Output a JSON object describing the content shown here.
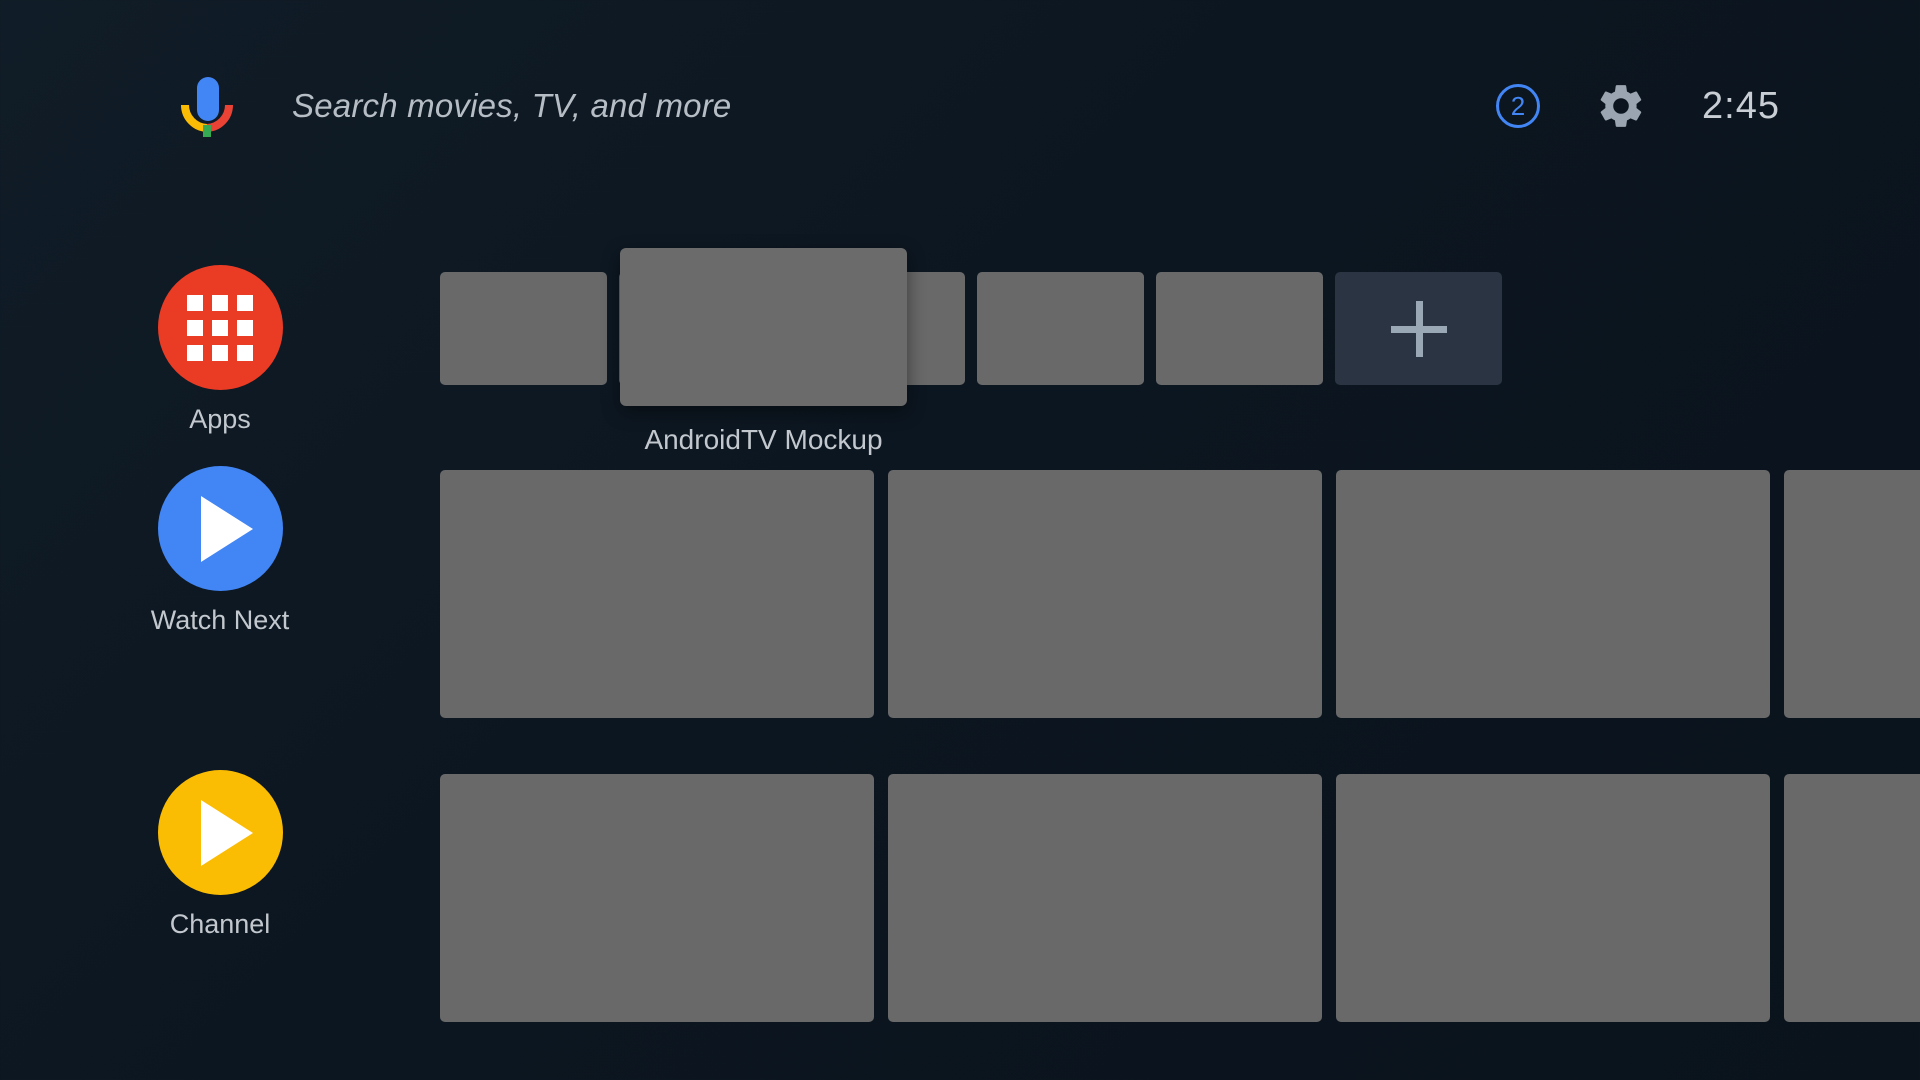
{
  "top_bar": {
    "mic_icon": "google-assistant-mic-icon",
    "search_placeholder": "Search movies, TV, and more",
    "notification_count": "2",
    "settings_icon": "gear-icon",
    "clock": "2:45"
  },
  "colors": {
    "background": "#0d1721",
    "accent_blue": "#4285f4",
    "apps_red": "#ea3c25",
    "watchnext_blue": "#4285f4",
    "channel_amber": "#fbbc04",
    "tile_gray": "#696969",
    "add_tile": "#2a3442",
    "text_gray": "#c2c8cd"
  },
  "rows": [
    {
      "label": "Apps",
      "icon": "apps-grid-icon",
      "icon_color": "#ea3c25",
      "tiles": [
        {
          "label": ""
        },
        {
          "label": ""
        },
        {
          "label": ""
        },
        {
          "label": ""
        },
        {
          "label": ""
        }
      ],
      "add_tile_label": "+",
      "focused_tile": {
        "label": "AndroidTV Mockup",
        "index": 1
      }
    },
    {
      "label": "Watch Next",
      "icon": "play-circle-icon",
      "icon_color": "#4285f4",
      "tiles": [
        {
          "label": ""
        },
        {
          "label": ""
        },
        {
          "label": ""
        },
        {
          "label": ""
        }
      ]
    },
    {
      "label": "Channel",
      "icon": "play-circle-icon",
      "icon_color": "#fbbc04",
      "tiles": [
        {
          "label": ""
        },
        {
          "label": ""
        },
        {
          "label": ""
        },
        {
          "label": ""
        }
      ]
    }
  ]
}
